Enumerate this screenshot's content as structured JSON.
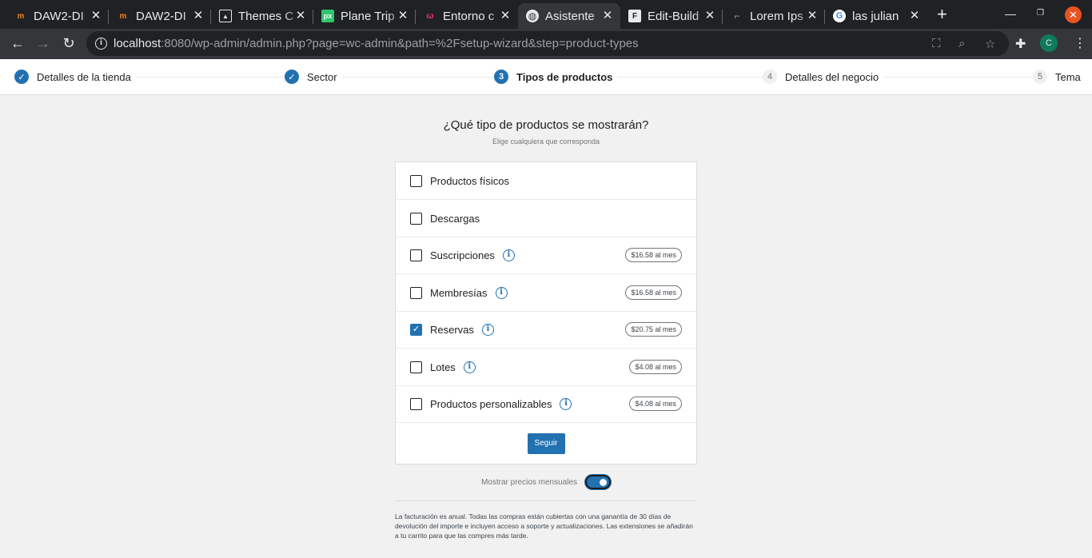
{
  "browser": {
    "tabs": [
      {
        "title": "DAW2-DI",
        "icon": "moodle-icon",
        "active": false
      },
      {
        "title": "DAW2-DI",
        "icon": "moodle-icon",
        "active": false
      },
      {
        "title": "Themes C",
        "icon": "image-icon",
        "active": false
      },
      {
        "title": "Plane Trip",
        "icon": "pixabay-icon",
        "active": false
      },
      {
        "title": "Entorno c",
        "icon": "entorno-icon",
        "active": false
      },
      {
        "title": "Asistente",
        "icon": "globe-icon",
        "active": true
      },
      {
        "title": "Edit-Build",
        "icon": "form-icon",
        "active": false
      },
      {
        "title": "Lorem Ips",
        "icon": "page-icon",
        "active": false
      },
      {
        "title": "las julian",
        "icon": "google-icon",
        "active": false
      }
    ],
    "url_host": "localhost",
    "url_rest": ":8080/wp-admin/admin.php?page=wc-admin&path=%2Fsetup-wizard&step=product-types",
    "profile_initial": "C"
  },
  "stepper": {
    "steps": [
      {
        "number": "1",
        "label": "Detalles de la tienda",
        "state": "done"
      },
      {
        "number": "2",
        "label": "Sector",
        "state": "done"
      },
      {
        "number": "3",
        "label": "Tipos de productos",
        "state": "current"
      },
      {
        "number": "4",
        "label": "Detalles del negocio",
        "state": "todo"
      },
      {
        "number": "5",
        "label": "Tema",
        "state": "todo"
      }
    ]
  },
  "main": {
    "title": "¿Qué tipo de productos se mostrarán?",
    "subtitle": "Elige cualquiera que corresponda",
    "product_types": [
      {
        "label": "Productos físicos",
        "checked": false,
        "info": false,
        "price": ""
      },
      {
        "label": "Descargas",
        "checked": false,
        "info": false,
        "price": ""
      },
      {
        "label": "Suscripciones",
        "checked": false,
        "info": true,
        "price": "$16.58 al mes"
      },
      {
        "label": "Membresías",
        "checked": false,
        "info": true,
        "price": "$16.58 al mes"
      },
      {
        "label": "Reservas",
        "checked": true,
        "info": true,
        "price": "$20.75 al mes"
      },
      {
        "label": "Lotes",
        "checked": false,
        "info": true,
        "price": "$4.08 al mes"
      },
      {
        "label": "Productos personalizables",
        "checked": false,
        "info": true,
        "price": "$4.08 al mes"
      }
    ],
    "continue_label": "Seguir",
    "monthly_toggle_label": "Mostrar precios mensuales",
    "monthly_toggle_on": true,
    "fineprint": "La facturación es anual. Todas las compras están cubiertas con una ganantía de 30 días de devolución del importe e incluyen acceso a soporte y actualizaciones. Las extensiones se añadirán a tu carrito para que las compres más tarde."
  },
  "colors": {
    "accent": "#2271b1",
    "chrome_dark": "#202124",
    "chrome_toolbar": "#35363a"
  }
}
